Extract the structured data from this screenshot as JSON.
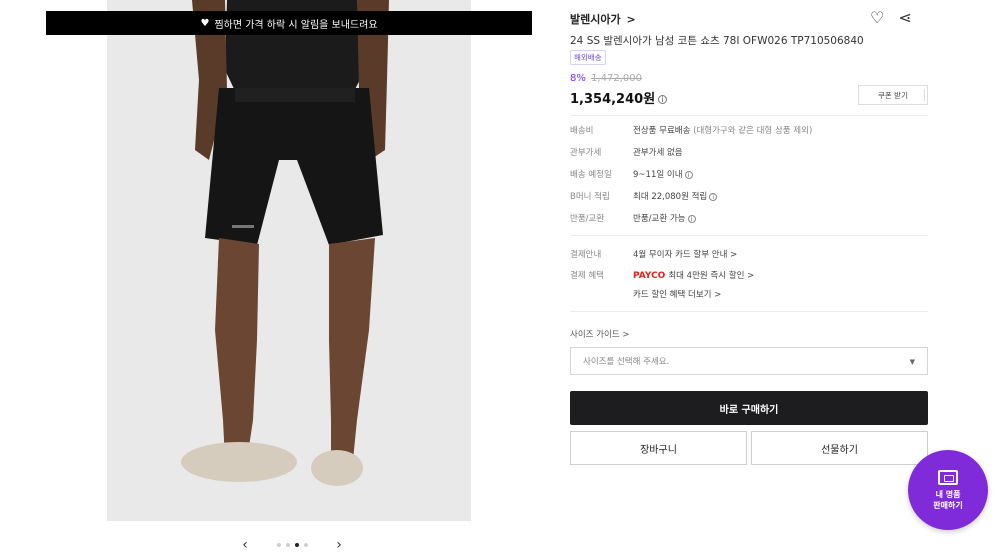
{
  "gallery": {
    "notice": "찜하면 가격 하락 시 알림을 보내드려요",
    "prev_label": "‹",
    "next_label": "›",
    "dots": 4,
    "active_dot": 3
  },
  "product": {
    "brand": "발렌시아가",
    "brand_chevron": ">",
    "title": "24 SS 발렌시아가 남성 코튼 쇼츠 78I OFW026 TP710506840",
    "badge": "해외배송",
    "discount_pct": "8%",
    "original_price": "1,472,000",
    "price": "1,354,240원",
    "coupon_label": "쿠폰 받기"
  },
  "details": [
    {
      "label": "배송비",
      "value": "전상품 무료배송",
      "sub": " (대형가구와 같은 대형 상품 제외)",
      "info": false
    },
    {
      "label": "관부가세",
      "value": "관부가세 없음",
      "sub": "",
      "info": false
    },
    {
      "label": "배송 예정일",
      "value": "9~11일 이내",
      "sub": "",
      "info": true
    },
    {
      "label": "B머니 적립",
      "value": "최대 22,080원 적립",
      "sub": "",
      "info": true
    },
    {
      "label": "반품/교환",
      "value": "반품/교환 가능",
      "sub": "",
      "info": true
    }
  ],
  "payment": {
    "installment_label": "결제안내",
    "installment_value": "4월 무이자 카드 할부 안내 >",
    "benefit_label": "결제 혜택",
    "payco": "PAYCO",
    "payco_value": "최대 4만원 즉시 할인 >",
    "card_more": "카드 할인 혜택 더보기 >"
  },
  "size": {
    "guide": "사이즈 가이드 >",
    "placeholder": "사이즈를 선택해 주세요."
  },
  "actions": {
    "buy": "바로 구매하기",
    "cart": "장바구니",
    "gift": "선물하기"
  },
  "fab": {
    "line1": "내 명품",
    "line2": "판매하기"
  },
  "colors": {
    "accent": "#7f2bd9",
    "discount": "#7b2bff",
    "payco": "#e0221a",
    "primary_button": "#1d1d1f"
  }
}
